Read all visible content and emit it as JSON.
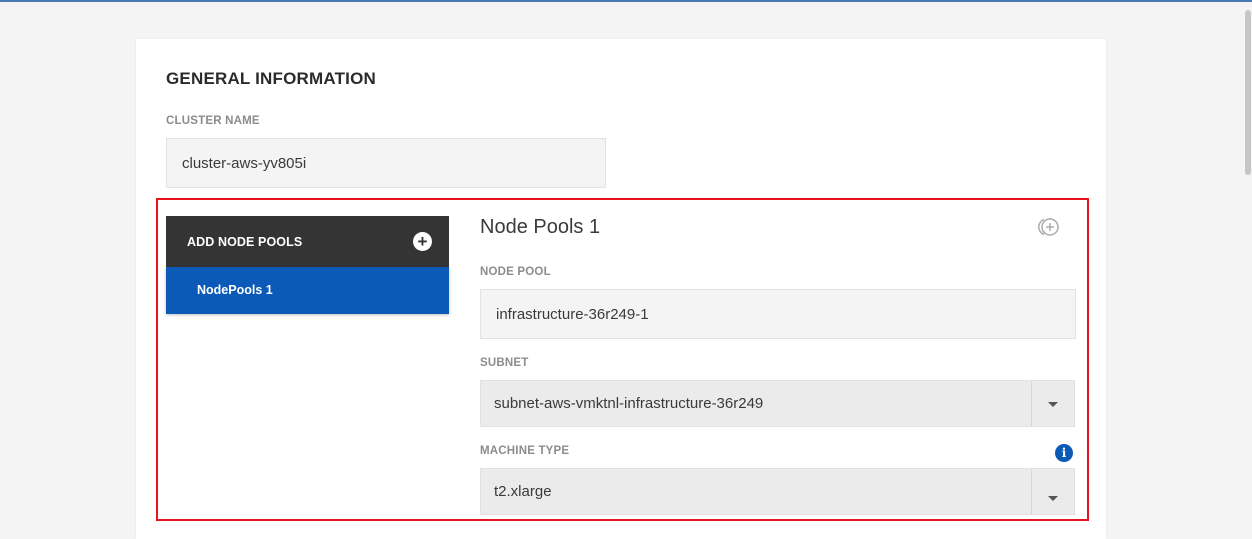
{
  "general": {
    "title": "GENERAL INFORMATION",
    "cluster_name_label": "CLUSTER NAME",
    "cluster_name_value": "cluster-aws-yv805i"
  },
  "node_pools": {
    "header_label": "ADD NODE POOLS",
    "header_icon": "plus-circle-icon",
    "items": [
      {
        "label": "NodePools 1",
        "selected": true
      }
    ]
  },
  "pool_detail": {
    "title": "Node Pools 1",
    "add_icon": "add-circle-outline-icon",
    "node_pool_label": "NODE POOL",
    "node_pool_value": "infrastructure-36r249-1",
    "subnet_label": "SUBNET",
    "subnet_value": "subnet-aws-vmktnl-infrastructure-36r249",
    "machine_type_label": "MACHINE TYPE",
    "machine_type_value": "t2.xlarge",
    "machine_type_info_icon": "info-icon"
  },
  "colors": {
    "accent": "#0b5ab8",
    "header_dark": "#343434",
    "highlight": "#e8141c"
  }
}
